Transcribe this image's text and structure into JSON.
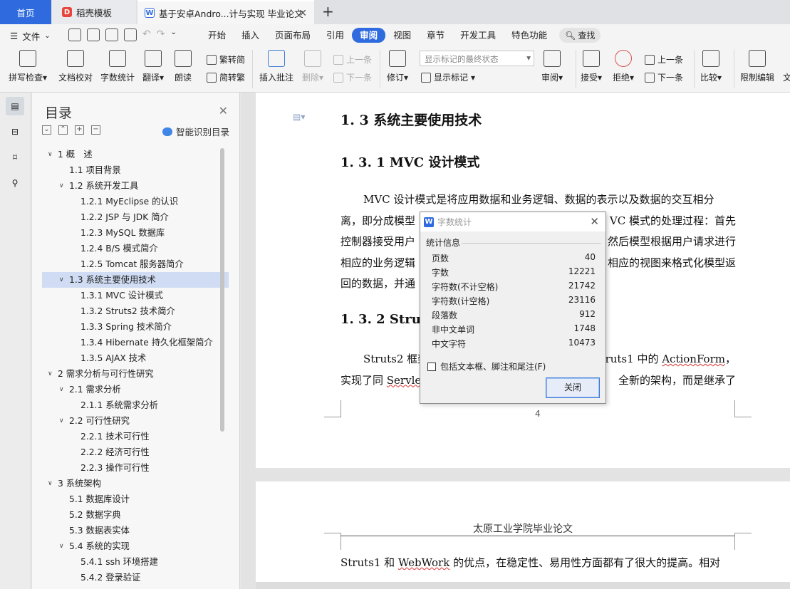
{
  "tabs": {
    "home": "首页",
    "template": "稻壳模板",
    "document": "基于安卓Andro...计与实现 毕业论文"
  },
  "menu": {
    "file": "文件",
    "tabs": [
      "开始",
      "插入",
      "页面布局",
      "引用",
      "审阅",
      "视图",
      "章节",
      "开发工具",
      "特色功能"
    ],
    "active_tab": "审阅",
    "search": "查找"
  },
  "ribbon": {
    "spell_check": "拼写检查",
    "doc_proof": "文档校对",
    "word_count": "字数统计",
    "translate": "翻译",
    "read_aloud": "朗读",
    "trad_to_simp": "繁转简",
    "simp_to_trad": "简转繁",
    "insert_comment": "插入批注",
    "delete": "删除",
    "prev_comment": "上一条",
    "next_comment": "下一条",
    "revise": "修订",
    "markup_mode": "显示标记的最终状态",
    "show_markup": "显示标记",
    "review": "审阅",
    "accept": "接受",
    "reject": "拒绝",
    "prev_change": "上一条",
    "next_change": "下一条",
    "compare": "比较",
    "restrict_edit": "限制编辑",
    "more": "文"
  },
  "toc": {
    "title": "目录",
    "smart": "智能识别目录",
    "items": [
      {
        "label": "1 概　述",
        "level": 0,
        "expanded": true
      },
      {
        "label": "1.1 项目背景",
        "level": 1
      },
      {
        "label": "1.2  系统开发工具",
        "level": 1,
        "expanded": true
      },
      {
        "label": "1.2.1 MyEclipse 的认识",
        "level": 2
      },
      {
        "label": "1.2.2 JSP 与 JDK 简介",
        "level": 2
      },
      {
        "label": "1.2.3 MySQL 数据库",
        "level": 2
      },
      {
        "label": "1.2.4 B/S 模式简介",
        "level": 2
      },
      {
        "label": "1.2.5 Tomcat 服务器简介",
        "level": 2
      },
      {
        "label": "1.3  系统主要使用技术",
        "level": 1,
        "expanded": true,
        "selected": true
      },
      {
        "label": "1.3.1 MVC 设计模式",
        "level": 2
      },
      {
        "label": "1.3.2 Struts2 技术简介",
        "level": 2
      },
      {
        "label": "1.3.3 Spring 技术简介",
        "level": 2
      },
      {
        "label": "1.3.4 Hibernate 持久化框架简介",
        "level": 2
      },
      {
        "label": "1.3.5 AJAX 技术",
        "level": 2
      },
      {
        "label": "2  需求分析与可行性研究",
        "level": 0,
        "expanded": true
      },
      {
        "label": "2.1 需求分析",
        "level": 1,
        "expanded": true
      },
      {
        "label": "2.1.1 系统需求分析",
        "level": 2
      },
      {
        "label": "2.2 可行性研究",
        "level": 1,
        "expanded": true
      },
      {
        "label": "2.2.1 技术可行性",
        "level": 2
      },
      {
        "label": "2.2.2 经济可行性",
        "level": 2
      },
      {
        "label": "2.2.3 操作可行性",
        "level": 2
      },
      {
        "label": "3 系统架构",
        "level": 0,
        "expanded": true
      },
      {
        "label": "5.1 数据库设计",
        "level": 1
      },
      {
        "label": "5.2 数据字典",
        "level": 1
      },
      {
        "label": "5.3  数据表实体",
        "level": 1
      },
      {
        "label": "5.4 系统的实现",
        "level": 1,
        "expanded": true
      },
      {
        "label": "5.4.1 ssh 环境搭建",
        "level": 2
      },
      {
        "label": "5.4.2 登录验证",
        "level": 2
      }
    ]
  },
  "document": {
    "h_1_3": "1. 3  系统主要使用技术",
    "h_1_3_1": "1. 3. 1  MVC 设计模式",
    "para1_l1": "MVC 设计模式是将应用数据和业务逻辑、数据的表示以及数据的交互相分",
    "para1_l2a": "离，即分成模型",
    "para1_l2b": "VC 模式的处理过程：首先",
    "para1_l3a": "控制器接受用户",
    "para1_l3b": "然后模型根据用户请求进行",
    "para1_l4a": "相应的业务逻辑",
    "para1_l4b": "相应的视图来格式化模型返",
    "para1_l5": "回的数据，并通",
    "h_1_3_2": "1. 3. 2  Struts",
    "para2_l1a": "Struts2 框架",
    "para2_l1b": "了 Struts1 中的 ",
    "para2_l1c": "ActionForm",
    "para2_l1d": "，",
    "para2_l2a": "实现了同 ",
    "para2_l2b": "Servlet",
    "para2_l2c": "全新的架构，而是继承了",
    "page_number": "4",
    "page2_header": "太原工业学院毕业论文",
    "page2_l1a": "Struts1 和 ",
    "page2_l1b": "WebWork",
    "page2_l1c": " 的优点，在稳定性、易用性方面都有了很大的提高。相对"
  },
  "dialog": {
    "title": "字数统计",
    "group": "统计信息",
    "stats": [
      {
        "label": "页数",
        "value": "40"
      },
      {
        "label": "字数",
        "value": "12221"
      },
      {
        "label": "字符数(不计空格)",
        "value": "21742"
      },
      {
        "label": "字符数(计空格)",
        "value": "23116"
      },
      {
        "label": "段落数",
        "value": "912"
      },
      {
        "label": "非中文单词",
        "value": "1748"
      },
      {
        "label": "中文字符",
        "value": "10473"
      }
    ],
    "checkbox": "包括文本框、脚注和尾注(F)",
    "close": "关闭"
  }
}
